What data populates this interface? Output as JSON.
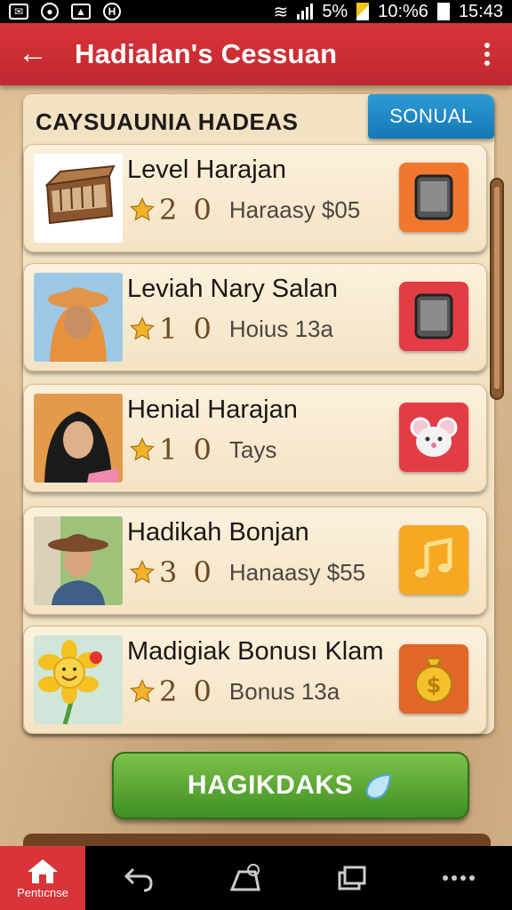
{
  "status_bar": {
    "battery": "5%",
    "signal": "10:%6",
    "time": "15:43"
  },
  "app_bar": {
    "title": "Hadialan's Cessuan"
  },
  "panel": {
    "header": "CAYSUAUNIA HADEAS",
    "tab_label": "SONUAL"
  },
  "items": [
    {
      "name": "Level Harajan",
      "points": "2 0",
      "desc": "Haraasy $05",
      "icon": "phone-icon",
      "color": "#f0782e"
    },
    {
      "name": "Leviah Nary Salan",
      "points": "1 0",
      "desc": "Hoius 13a",
      "icon": "phone-icon",
      "color": "#e23c45"
    },
    {
      "name": "Henial Harajan",
      "points": "1 0",
      "desc": "Tays",
      "icon": "mouse-face-icon",
      "color": "#e23c45"
    },
    {
      "name": "Hadikah Bonjan",
      "points": "3 0",
      "desc": "Hanaasy $55",
      "icon": "music-note-icon",
      "color": "#f7a823"
    },
    {
      "name": "Madigiak Bonusı Klam",
      "points": "2 0",
      "desc": "Bonus 13a",
      "icon": "money-bag-icon",
      "color": "#f0782e"
    }
  ],
  "primary_button": {
    "label": "HAGIKDAKS"
  },
  "nav": {
    "home_label": "Pentıcnse"
  }
}
